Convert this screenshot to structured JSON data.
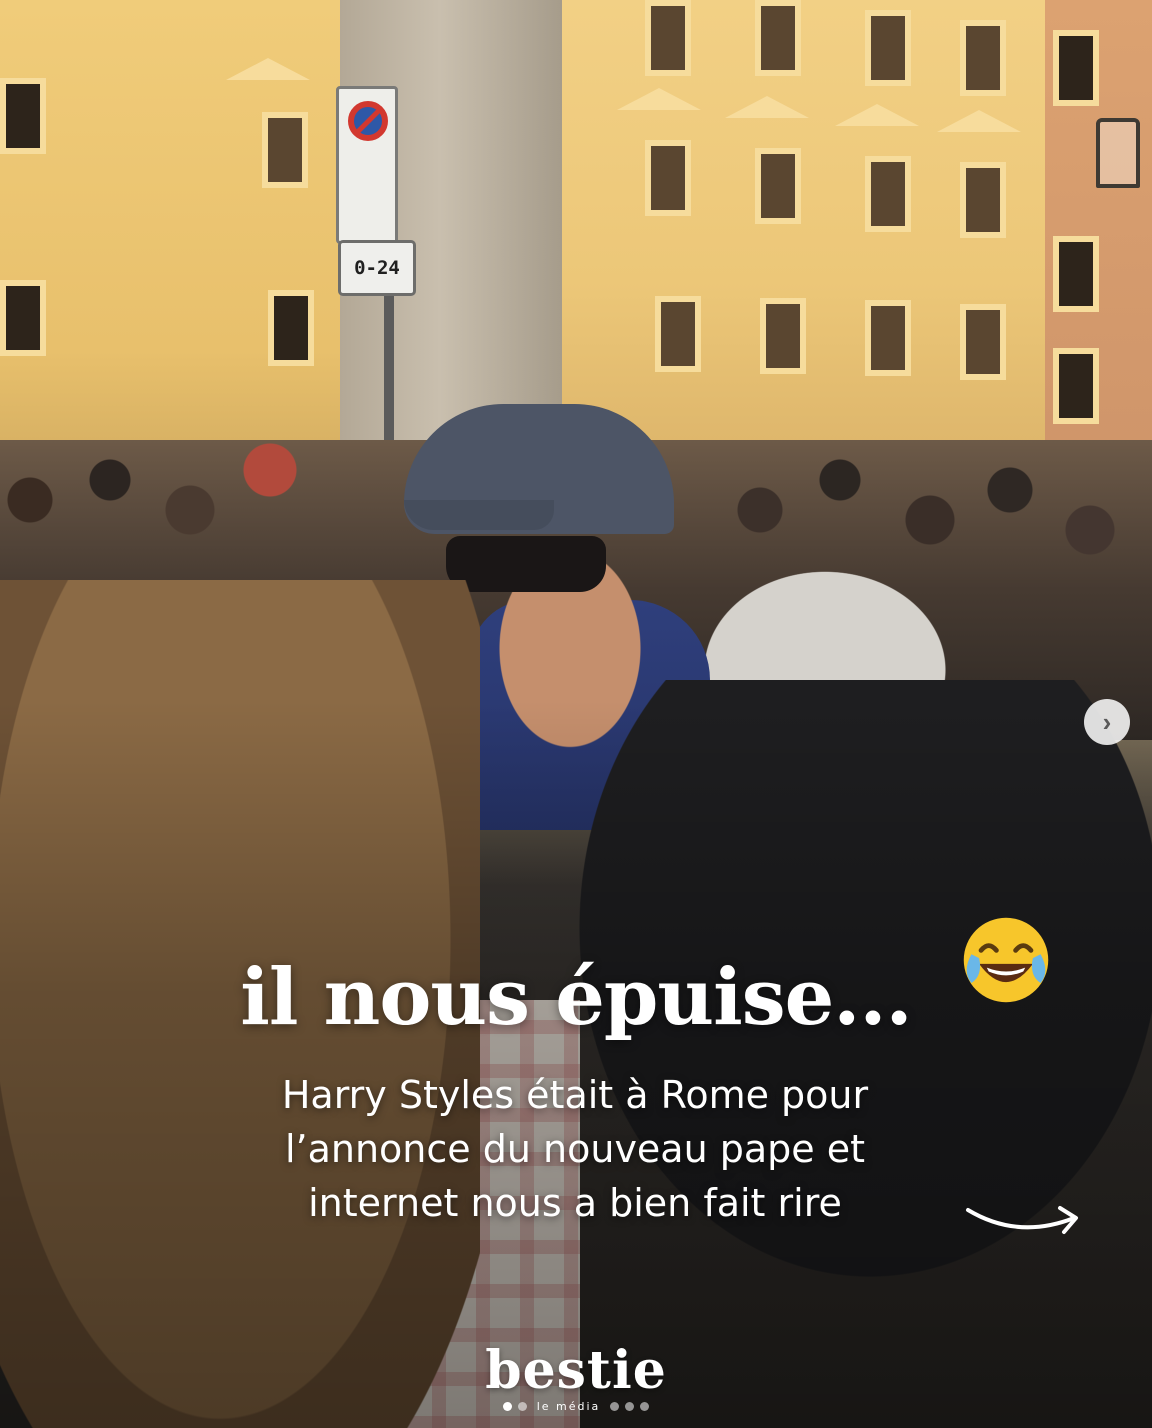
{
  "post": {
    "sign_hours": "0-24",
    "headline": "il nous épuise...",
    "emoji": "face-with-tears-of-joy-icon",
    "subtitle_lines": [
      "Harry Styles était à Rome pour",
      "l’annonce du nouveau pape et",
      "internet nous a bien fait rire"
    ],
    "next_button_icon": "chevron-right-icon",
    "swipe_arrow_icon": "curved-arrow-right-icon"
  },
  "brand": {
    "name": "bestie",
    "tagline": "le média"
  },
  "carousel": {
    "total_slides": 5,
    "active_slide": 1
  },
  "colors": {
    "text": "#ffffff",
    "emoji_face": "#f7c62b",
    "tears": "#6ab7e8"
  }
}
